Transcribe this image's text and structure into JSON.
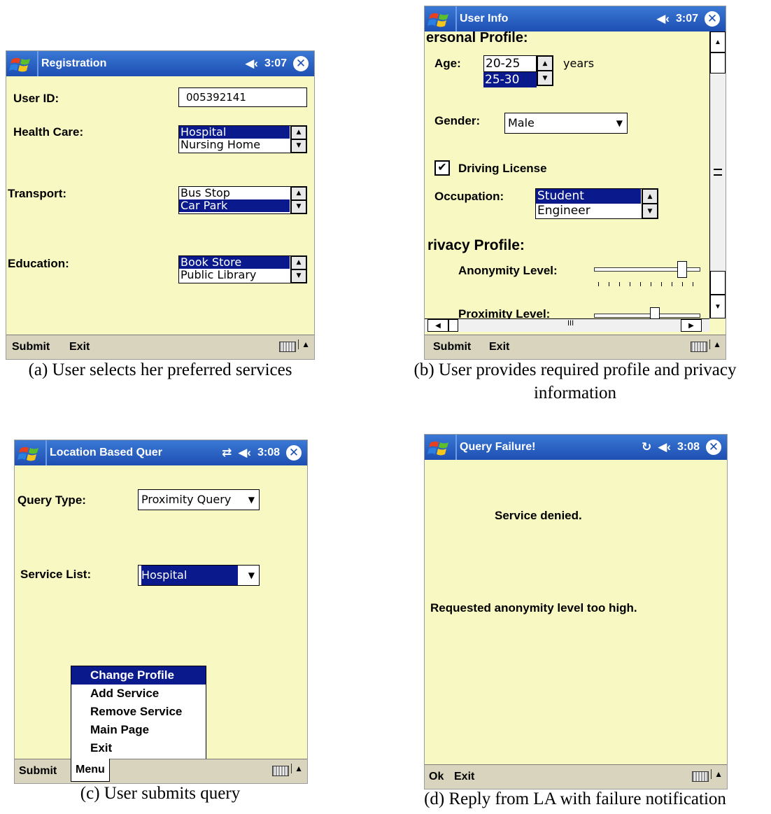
{
  "common": {
    "close_glyph": "✕",
    "speaker_glyph": "◀‹",
    "keyboard_up": "▲",
    "arrow_down": "▼",
    "arrow_up": "▲"
  },
  "panel_a": {
    "title": "Registration",
    "time": "3:07",
    "user_id_label": "User ID:",
    "user_id_value": "005392141",
    "health_label": "Health Care:",
    "health_items": [
      "Hospital",
      "Nursing Home"
    ],
    "transport_label": "Transport:",
    "transport_items": [
      "Bus Stop",
      "Car Park"
    ],
    "education_label": "Education:",
    "education_items": [
      "Book Store",
      "Public Library"
    ],
    "softkey_left": "Submit",
    "softkey_right": "Exit",
    "caption": "(a) User selects her preferred services"
  },
  "panel_b": {
    "title": "User Info",
    "time": "3:07",
    "personal_heading": "ersonal Profile:",
    "age_label": "Age:",
    "age_items": [
      "20-25",
      "25-30"
    ],
    "age_unit": "years",
    "gender_label": "Gender:",
    "gender_value": "Male",
    "driving_label": "Driving License",
    "driving_checked": true,
    "occupation_label": "Occupation:",
    "occupation_items": [
      "Student",
      "Engineer"
    ],
    "privacy_heading": "rivacy Profile:",
    "anonymity_label": "Anonymity Level:",
    "anonymity_level": 0.86,
    "proximity_label": "Proximity Level:",
    "proximity_level": 0.58,
    "hscroll_mark": "III",
    "softkey_left": "Submit",
    "softkey_right": "Exit",
    "caption_line1": "(b) User provides required profile and privacy",
    "caption_line2": "information"
  },
  "panel_c": {
    "title": "Location Based Quer",
    "time": "3:08",
    "query_type_label": "Query Type:",
    "query_type_value": "Proximity Query",
    "service_list_label": "Service List:",
    "service_list_value": "Hospital",
    "menu_items": [
      "Change Profile",
      "Add Service",
      "Remove Service",
      "Main Page",
      "Exit"
    ],
    "softkey_left": "Submit",
    "softkey_right": "Menu",
    "caption": "(c) User submits query"
  },
  "panel_d": {
    "title": "Query Failure!",
    "time": "3:08",
    "message1": "Service denied.",
    "message2": "Requested anonymity level too high.",
    "softkey_left": "Ok",
    "softkey_right": "Exit",
    "caption": "(d) Reply from LA with failure notification"
  }
}
